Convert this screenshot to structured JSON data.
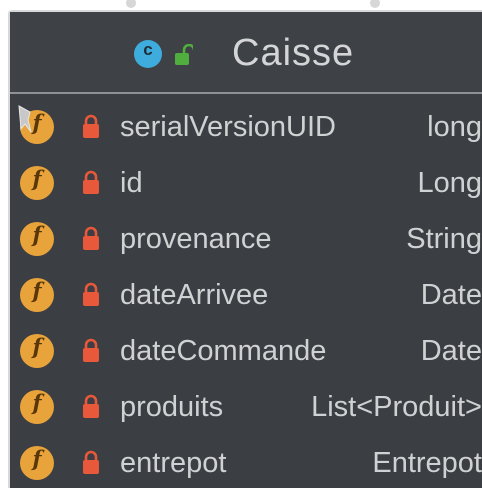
{
  "class": {
    "kind_letter": "c",
    "name": "Caisse",
    "kind_icon": "class-icon",
    "visibility_icon": "lock-open-icon",
    "accent": "#3eaddd"
  },
  "fields": [
    {
      "name": "serialVersionUID",
      "type": "long",
      "icon": "field-icon",
      "visibility": "lock-icon",
      "static": true
    },
    {
      "name": "id",
      "type": "Long",
      "icon": "field-icon",
      "visibility": "lock-icon",
      "static": false
    },
    {
      "name": "provenance",
      "type": "String",
      "icon": "field-icon",
      "visibility": "lock-icon",
      "static": false
    },
    {
      "name": "dateArrivee",
      "type": "Date",
      "icon": "field-icon",
      "visibility": "lock-icon",
      "static": false
    },
    {
      "name": "dateCommande",
      "type": "Date",
      "icon": "field-icon",
      "visibility": "lock-icon",
      "static": false
    },
    {
      "name": "produits",
      "type": "List<Produit>",
      "icon": "field-icon",
      "visibility": "lock-icon",
      "static": false
    },
    {
      "name": "entrepot",
      "type": "Entrepot",
      "icon": "field-icon",
      "visibility": "lock-icon",
      "static": false
    }
  ],
  "field_icon_letter": "f",
  "colors": {
    "background": "#3b3e42",
    "field_icon": "#e9a33b",
    "private_lock": "#e8583b",
    "public_lock": "#4fae3d",
    "text": "#cfd1d2"
  }
}
